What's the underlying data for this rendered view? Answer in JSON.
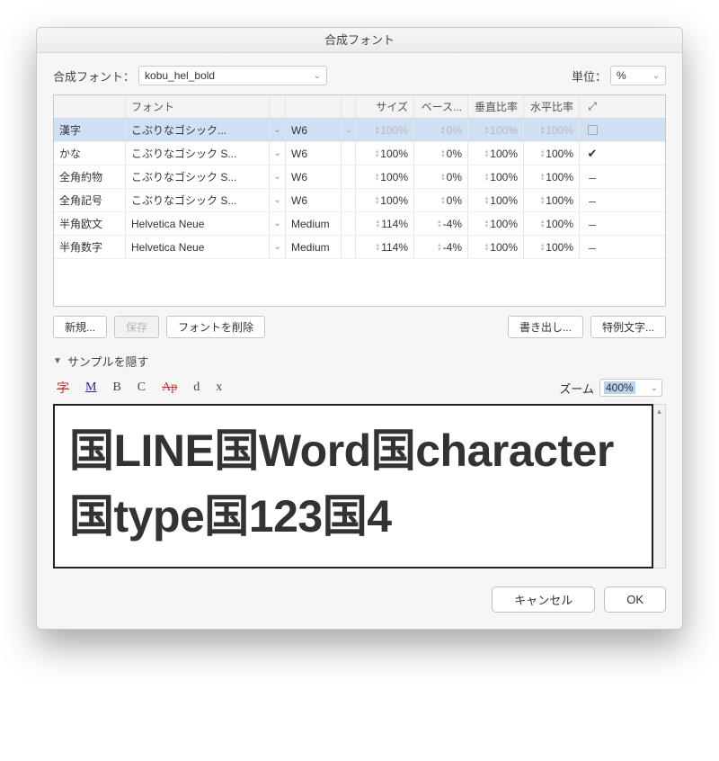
{
  "window": {
    "title": "合成フォント"
  },
  "header": {
    "font_label": "合成フォント：",
    "font_value": "kobu_hel_bold",
    "unit_label": "単位：",
    "unit_value": "%"
  },
  "columns": {
    "type": "",
    "font": "フォント",
    "weight": "",
    "size": "サイズ",
    "base": "ベース...",
    "vert": "垂直比率",
    "horz": "水平比率",
    "flag": "⤢"
  },
  "rows": [
    {
      "type": "漢字",
      "font": "こぶりなゴシック...",
      "weight": "W6",
      "size": "100%",
      "base": "0%",
      "vert": "100%",
      "horz": "100%",
      "flag": "□",
      "selected": true,
      "dim": true
    },
    {
      "type": "かな",
      "font": "こぶりなゴシック S...",
      "weight": "W6",
      "size": "100%",
      "base": "0%",
      "vert": "100%",
      "horz": "100%",
      "flag": "✔",
      "selected": false,
      "dim": false
    },
    {
      "type": "全角約物",
      "font": "こぶりなゴシック S...",
      "weight": "W6",
      "size": "100%",
      "base": "0%",
      "vert": "100%",
      "horz": "100%",
      "flag": "–",
      "selected": false,
      "dim": false
    },
    {
      "type": "全角記号",
      "font": "こぶりなゴシック S...",
      "weight": "W6",
      "size": "100%",
      "base": "0%",
      "vert": "100%",
      "horz": "100%",
      "flag": "–",
      "selected": false,
      "dim": false
    },
    {
      "type": "半角欧文",
      "font": "Helvetica Neue",
      "weight": "Medium",
      "size": "114%",
      "base": "-4%",
      "vert": "100%",
      "horz": "100%",
      "flag": "–",
      "selected": false,
      "dim": false
    },
    {
      "type": "半角数字",
      "font": "Helvetica Neue",
      "weight": "Medium",
      "size": "114%",
      "base": "-4%",
      "vert": "100%",
      "horz": "100%",
      "flag": "–",
      "selected": false,
      "dim": false
    }
  ],
  "buttons": {
    "new": "新規...",
    "save": "保存",
    "delete": "フォントを削除",
    "export": "書き出し...",
    "special": "特例文字..."
  },
  "disclosure": {
    "label": "サンプルを隠す"
  },
  "toolbar": {
    "icons": [
      "字",
      "M",
      "B",
      "C",
      "Ap",
      "d",
      "x"
    ],
    "zoom_label": "ズーム",
    "zoom_value": "400%"
  },
  "preview": {
    "sample": "国LINE国Word国character国type国123国4"
  },
  "footer": {
    "cancel": "キャンセル",
    "ok": "OK"
  }
}
